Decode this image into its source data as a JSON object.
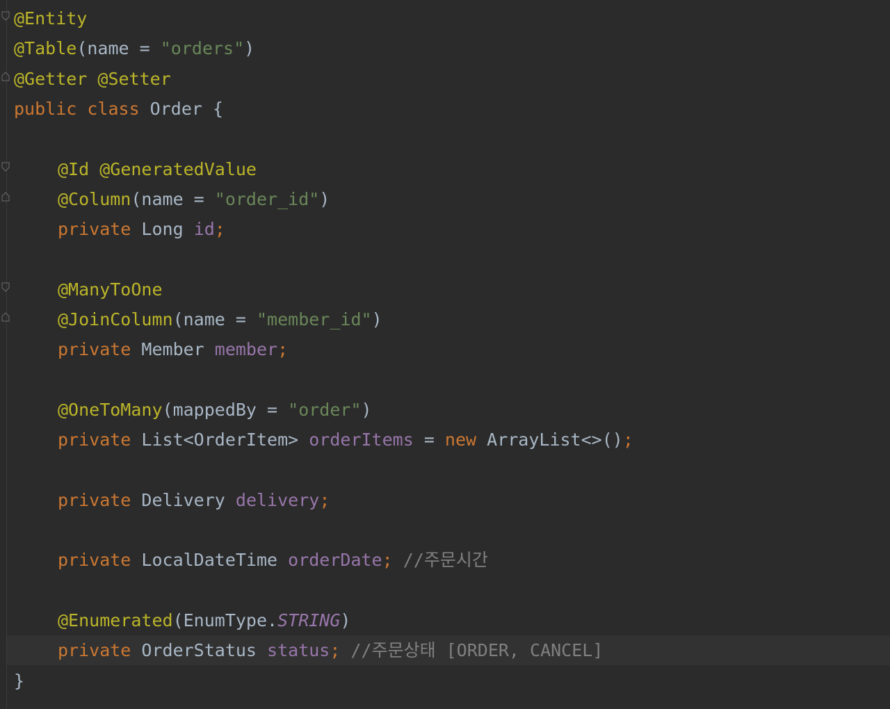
{
  "code": {
    "lines": [
      {
        "tokens": [
          {
            "t": "ann",
            "v": "@Entity"
          }
        ]
      },
      {
        "tokens": [
          {
            "t": "ann",
            "v": "@Table"
          },
          {
            "t": "plain",
            "v": "(name = "
          },
          {
            "t": "str",
            "v": "\"orders\""
          },
          {
            "t": "plain",
            "v": ")"
          }
        ]
      },
      {
        "tokens": [
          {
            "t": "ann",
            "v": "@Getter"
          },
          {
            "t": "plain",
            "v": " "
          },
          {
            "t": "ann",
            "v": "@Setter"
          }
        ]
      },
      {
        "tokens": [
          {
            "t": "kw",
            "v": "public class "
          },
          {
            "t": "plain",
            "v": "Order {"
          }
        ]
      },
      {
        "tokens": []
      },
      {
        "tokens": [
          {
            "t": "ann",
            "v": "@Id"
          },
          {
            "t": "plain",
            "v": " "
          },
          {
            "t": "ann",
            "v": "@GeneratedValue"
          }
        ]
      },
      {
        "tokens": [
          {
            "t": "ann",
            "v": "@Column"
          },
          {
            "t": "plain",
            "v": "(name = "
          },
          {
            "t": "str",
            "v": "\"order_id\""
          },
          {
            "t": "plain",
            "v": ")"
          }
        ]
      },
      {
        "tokens": [
          {
            "t": "kw",
            "v": "private "
          },
          {
            "t": "plain",
            "v": "Long "
          },
          {
            "t": "fld",
            "v": "id"
          },
          {
            "t": "kw",
            "v": ";"
          }
        ]
      },
      {
        "tokens": []
      },
      {
        "tokens": [
          {
            "t": "ann",
            "v": "@ManyToOne"
          }
        ]
      },
      {
        "tokens": [
          {
            "t": "ann",
            "v": "@JoinColumn"
          },
          {
            "t": "plain",
            "v": "(name = "
          },
          {
            "t": "str",
            "v": "\"member_id\""
          },
          {
            "t": "plain",
            "v": ")"
          }
        ]
      },
      {
        "tokens": [
          {
            "t": "kw",
            "v": "private "
          },
          {
            "t": "plain",
            "v": "Member "
          },
          {
            "t": "fld",
            "v": "member"
          },
          {
            "t": "kw",
            "v": ";"
          }
        ]
      },
      {
        "tokens": []
      },
      {
        "tokens": [
          {
            "t": "ann",
            "v": "@OneToMany"
          },
          {
            "t": "plain",
            "v": "(mappedBy = "
          },
          {
            "t": "str",
            "v": "\"order\""
          },
          {
            "t": "plain",
            "v": ")"
          }
        ]
      },
      {
        "tokens": [
          {
            "t": "kw",
            "v": "private "
          },
          {
            "t": "plain",
            "v": "List<OrderItem> "
          },
          {
            "t": "fld",
            "v": "orderItems"
          },
          {
            "t": "plain",
            "v": " = "
          },
          {
            "t": "kw",
            "v": "new "
          },
          {
            "t": "plain",
            "v": "ArrayList<>()"
          },
          {
            "t": "kw",
            "v": ";"
          }
        ]
      },
      {
        "tokens": []
      },
      {
        "tokens": [
          {
            "t": "kw",
            "v": "private "
          },
          {
            "t": "plain",
            "v": "Delivery "
          },
          {
            "t": "fld",
            "v": "delivery"
          },
          {
            "t": "kw",
            "v": ";"
          }
        ]
      },
      {
        "tokens": []
      },
      {
        "tokens": [
          {
            "t": "kw",
            "v": "private "
          },
          {
            "t": "plain",
            "v": "LocalDateTime "
          },
          {
            "t": "fld",
            "v": "orderDate"
          },
          {
            "t": "kw",
            "v": "; "
          },
          {
            "t": "cmt",
            "v": "//주문시간"
          }
        ]
      },
      {
        "tokens": []
      },
      {
        "tokens": [
          {
            "t": "ann",
            "v": "@Enumerated"
          },
          {
            "t": "plain",
            "v": "(EnumType."
          },
          {
            "t": "enumc",
            "v": "STRING"
          },
          {
            "t": "plain",
            "v": ")"
          }
        ]
      },
      {
        "tokens": [
          {
            "t": "kw",
            "v": "private "
          },
          {
            "t": "plain",
            "v": "OrderStatus "
          },
          {
            "t": "fld",
            "v": "status"
          },
          {
            "t": "kw",
            "v": "; "
          },
          {
            "t": "cmt",
            "v": "//주문상태 [ORDER, CANCEL]"
          }
        ]
      },
      {
        "tokens": [
          {
            "t": "plain",
            "v": "}"
          }
        ]
      }
    ]
  },
  "colors": {
    "background": "#2b2b2b",
    "annotation": "#bbb529",
    "keyword": "#cc7832",
    "string": "#6a8759",
    "field": "#9876aa",
    "comment": "#808080",
    "text": "#a9b7c6",
    "caret_row": "#323232"
  },
  "icons": [
    "fold-start-icon",
    "fold-end-icon"
  ]
}
